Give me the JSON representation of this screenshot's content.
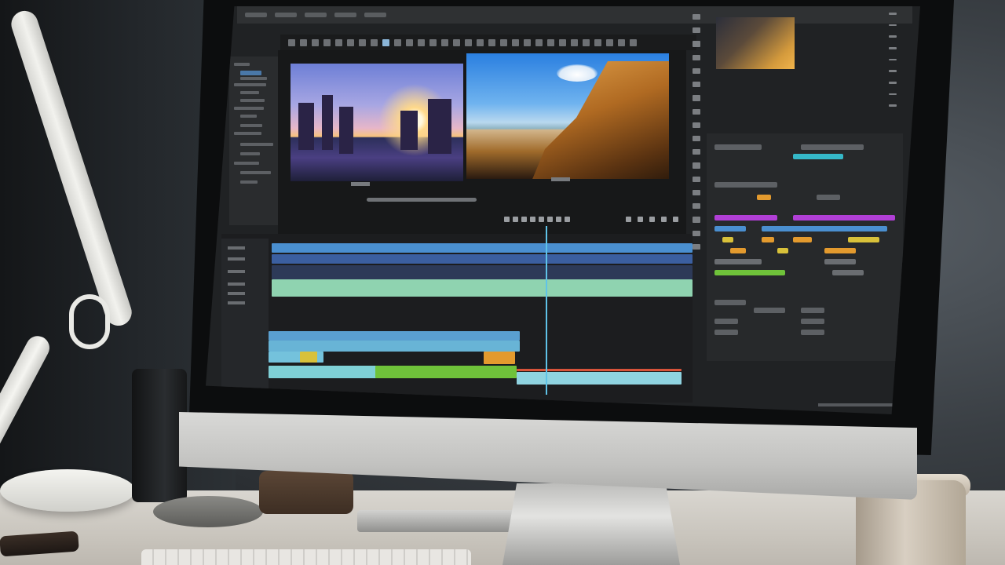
{
  "scene": {
    "description_items": [
      "monitor",
      "desk-lamp",
      "speaker",
      "coffee-cup",
      "keyboard",
      "phone"
    ]
  },
  "editor": {
    "program_monitor": {
      "left_clip": "sunset-flags",
      "right_clip": "cliff-coast"
    },
    "timeline": {
      "video_tracks": 3,
      "audio_tracks": 3
    },
    "colors": {
      "screen_bg": "#202224",
      "playhead": "#5fc3e8",
      "audio_green": "#8fd3b0",
      "video_blue": "#4a8fd0",
      "clip_orange": "#e39a2e",
      "clip_yellow": "#d8c13a",
      "clip_purple": "#b13fd6",
      "clip_lime": "#6fc23a"
    }
  }
}
